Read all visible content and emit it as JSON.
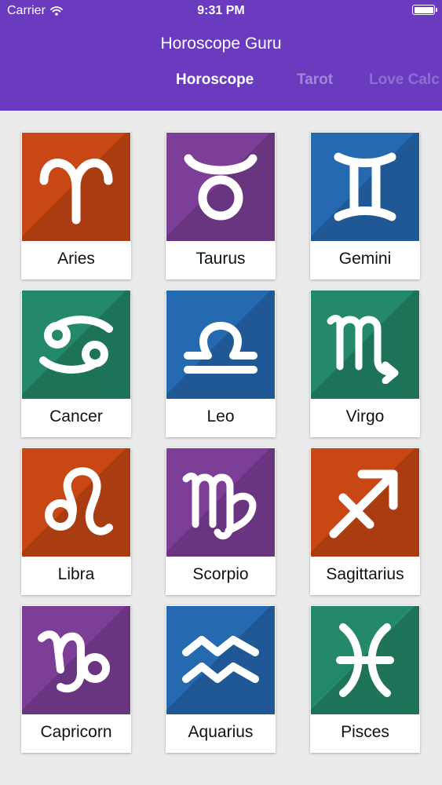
{
  "status_bar": {
    "carrier": "Carrier",
    "time": "9:31 PM"
  },
  "header": {
    "title": "Horoscope Guru",
    "background": "#6a3bbf",
    "tabs": [
      {
        "label": "Horoscope",
        "active": true
      },
      {
        "label": "Tarot",
        "active": false
      },
      {
        "label": "Love Calc",
        "active": false
      }
    ]
  },
  "signs": [
    {
      "name": "Aries",
      "icon": "aries-icon",
      "color": "#c94714"
    },
    {
      "name": "Taurus",
      "icon": "taurus-icon",
      "color": "#7d3e98"
    },
    {
      "name": "Gemini",
      "icon": "gemini-icon",
      "color": "#2569b0"
    },
    {
      "name": "Cancer",
      "icon": "cancer-icon",
      "color": "#23896a"
    },
    {
      "name": "Leo",
      "icon": "libra-icon",
      "color": "#2569b0"
    },
    {
      "name": "Virgo",
      "icon": "scorpio-icon",
      "color": "#23896a"
    },
    {
      "name": "Libra",
      "icon": "leo-icon",
      "color": "#c94714"
    },
    {
      "name": "Scorpio",
      "icon": "virgo-icon",
      "color": "#7d3e98"
    },
    {
      "name": "Sagittarius",
      "icon": "sagittarius-icon",
      "color": "#c94714"
    },
    {
      "name": "Capricorn",
      "icon": "capricorn-icon",
      "color": "#7d3e98"
    },
    {
      "name": "Aquarius",
      "icon": "aquarius-icon",
      "color": "#2569b0"
    },
    {
      "name": "Pisces",
      "icon": "pisces-icon",
      "color": "#23896a"
    }
  ]
}
